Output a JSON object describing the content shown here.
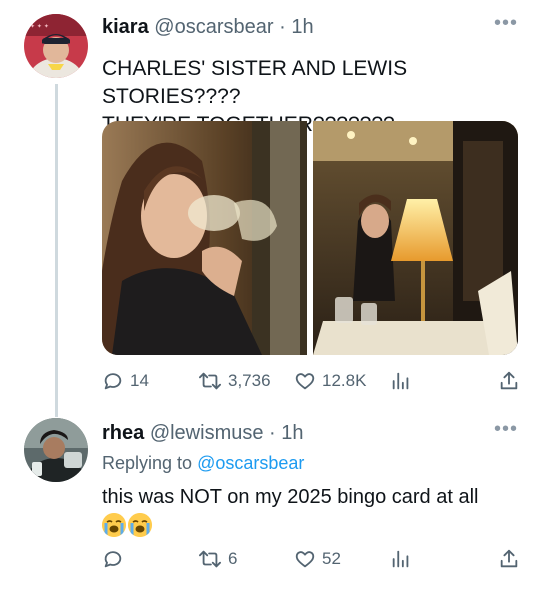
{
  "tweets": [
    {
      "name": "kiara",
      "handle": "@oscarsbear",
      "separator": "·",
      "time": "1h",
      "text_line1": "CHARLES' SISTER AND LEWIS STORIES????",
      "text_line2": "THEY'RE TOGETHER???????",
      "more_icon": "more-dots-icon",
      "media": [
        {
          "description_icon": "photo-woman-drinking-glass"
        },
        {
          "description_icon": "photo-restaurant-lamp"
        }
      ],
      "actions": {
        "replies": "14",
        "retweets": "3,736",
        "likes": "12.8K"
      }
    },
    {
      "name": "rhea",
      "handle": "@lewismuse",
      "separator": "·",
      "time": "1h",
      "replying_prefix": "Replying to",
      "replying_to": "@oscarsbear",
      "text": "this was NOT on my 2025 bingo card at all",
      "emojis": [
        "loudly-crying-face",
        "loudly-crying-face"
      ],
      "more_icon": "more-dots-icon",
      "actions": {
        "replies": "",
        "retweets": "6",
        "likes": "52"
      }
    }
  ],
  "colors": {
    "text": "#0f1419",
    "muted": "#536471",
    "link": "#1d9bf0",
    "line": "#cfd9de"
  }
}
